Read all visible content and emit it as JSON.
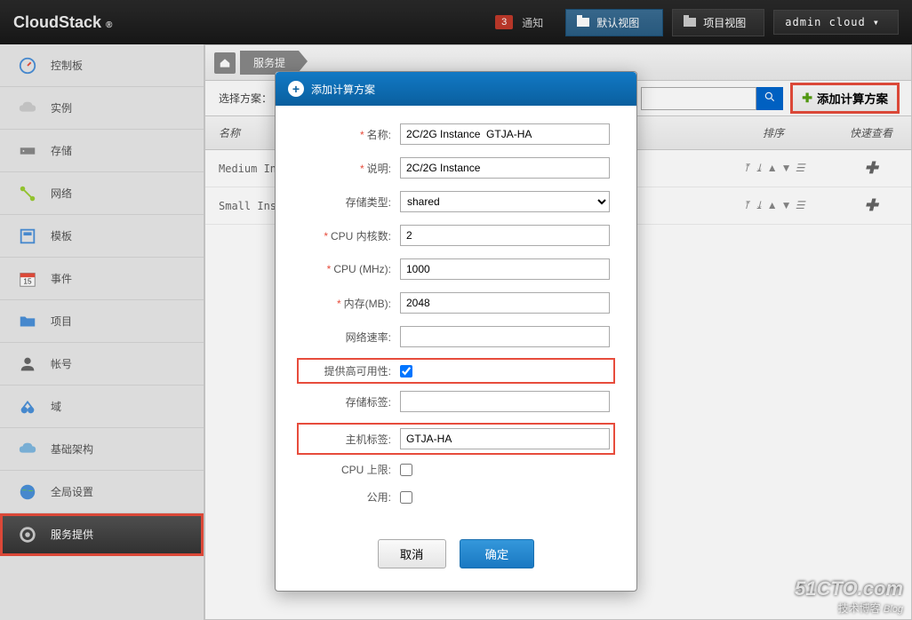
{
  "header": {
    "logo": "CloudStack",
    "logo_tm": "®",
    "notify_count": "3",
    "notify_label": "通知",
    "view_default": "默认视图",
    "view_project": "项目视图",
    "user": "admin cloud"
  },
  "sidebar": {
    "items": [
      {
        "label": "控制板",
        "icon": "dashboard"
      },
      {
        "label": "实例",
        "icon": "cloud"
      },
      {
        "label": "存储",
        "icon": "storage"
      },
      {
        "label": "网络",
        "icon": "network"
      },
      {
        "label": "模板",
        "icon": "template"
      },
      {
        "label": "事件",
        "icon": "calendar"
      },
      {
        "label": "项目",
        "icon": "folder"
      },
      {
        "label": "帐号",
        "icon": "user"
      },
      {
        "label": "域",
        "icon": "domain"
      },
      {
        "label": "基础架构",
        "icon": "infra"
      },
      {
        "label": "全局设置",
        "icon": "globe"
      },
      {
        "label": "服务提供",
        "icon": "gear",
        "active": true
      }
    ]
  },
  "breadcrumb": {
    "item1": "服务提"
  },
  "filter": {
    "label": "选择方案：",
    "add_btn": "添加计算方案"
  },
  "table": {
    "col_name": "名称",
    "col_order": "排序",
    "col_view": "快速查看",
    "rows": [
      {
        "name": "Medium In"
      },
      {
        "name": "Small Ins"
      }
    ]
  },
  "modal": {
    "title": "添加计算方案",
    "fields": {
      "name_label": "名称:",
      "name_value": "2C/2G Instance  GTJA-HA",
      "desc_label": "说明:",
      "desc_value": "2C/2G Instance",
      "storage_type_label": "存储类型:",
      "storage_type_value": "shared",
      "cpu_cores_label": "CPU 内核数:",
      "cpu_cores_value": "2",
      "cpu_mhz_label": "CPU (MHz):",
      "cpu_mhz_value": "1000",
      "memory_label": "内存(MB):",
      "memory_value": "2048",
      "network_rate_label": "网络速率:",
      "network_rate_value": "",
      "ha_label": "提供高可用性:",
      "ha_checked": true,
      "storage_tag_label": "存储标签:",
      "storage_tag_value": "",
      "host_tag_label": "主机标签:",
      "host_tag_value": "GTJA-HA",
      "cpu_cap_label": "CPU 上限:",
      "cpu_cap_checked": false,
      "public_label": "公用:",
      "public_checked": false
    },
    "cancel": "取消",
    "ok": "确定"
  },
  "watermark": {
    "line1": "51CTO.com",
    "line2": "技术博客",
    "line3": "Blog"
  }
}
